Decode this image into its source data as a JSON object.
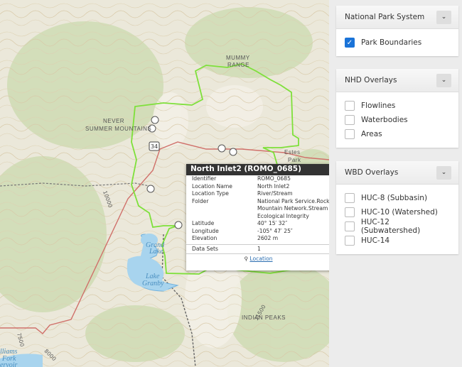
{
  "map": {
    "labels": {
      "mummy_range_1": "MUMMY",
      "mummy_range_2": "RANGE",
      "never_summer_1": "NEVER",
      "never_summer_2": "SUMMER MOUNTAINS",
      "estes_1": "Estes",
      "estes_2": "Park",
      "grand_1": "Grand",
      "grand_2": "Lake",
      "granby_1": "Lake",
      "granby_2": "Granby",
      "indian_peaks": "INDIAN PEAKS",
      "williams_1": "lliams",
      "williams_2": "Fork",
      "williams_3": "ervoir",
      "highway": "34",
      "contour_1": "11500",
      "contour_2": "7500",
      "contour_3": "8000",
      "contour_4": "10000"
    },
    "colors": {
      "boundary": "#7ee03a",
      "water": "#a8d4ee",
      "road": "#d0706a"
    }
  },
  "popup": {
    "title": "North Inlet2 (ROMO_0685)",
    "rows": [
      {
        "key": "Identifier",
        "value": "ROMO_0685"
      },
      {
        "key": "Location Name",
        "value": "North Inlet2"
      },
      {
        "key": "Location Type",
        "value": "River/Stream"
      },
      {
        "key": "Folder",
        "value": "National Park Service.Rocky Mountain Network.Stream Ecological Integrity"
      },
      {
        "key": "Latitude",
        "value": "40° 15′ 32″"
      },
      {
        "key": "Longitude",
        "value": "-105° 47′ 25″"
      },
      {
        "key": "Elevation",
        "value": "2602 m"
      }
    ],
    "folder_lines": [
      "National Park Service.Rock",
      "Mountain Network.Stream",
      "Ecological Integrity"
    ],
    "datasets_key": "Data Sets",
    "datasets_value": "1",
    "location_link": "Location"
  },
  "panel": {
    "nps": {
      "title": "National Park System",
      "items": [
        {
          "label": "Park Boundaries",
          "checked": true
        }
      ]
    },
    "nhd": {
      "title": "NHD Overlays",
      "items": [
        {
          "label": "Flowlines",
          "checked": false
        },
        {
          "label": "Waterbodies",
          "checked": false
        },
        {
          "label": "Areas",
          "checked": false
        }
      ]
    },
    "wbd": {
      "title": "WBD Overlays",
      "items": [
        {
          "label": "HUC-8 (Subbasin)",
          "checked": false
        },
        {
          "label": "HUC-10 (Watershed)",
          "checked": false
        },
        {
          "label": "HUC-12 (Subwatershed)",
          "checked": false
        },
        {
          "label": "HUC-14",
          "checked": false
        }
      ]
    },
    "accent": "#1a73d8"
  }
}
